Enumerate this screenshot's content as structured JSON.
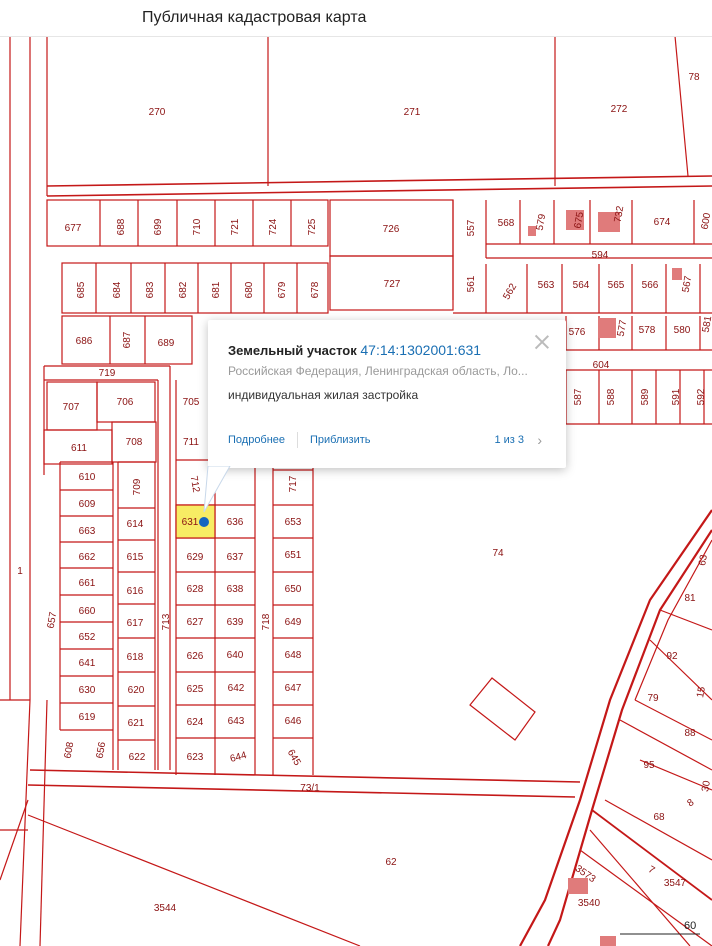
{
  "app": {
    "title": "Публичная кадастровая карта"
  },
  "popup": {
    "title": "Земельный участок",
    "cadastral_number": "47:14:1302001:631",
    "address": "Российская Федерация, Ленинградская область, Ло...",
    "usage": "индивидуальная жилая застройка",
    "details_label": "Подробнее",
    "zoom_label": "Приблизить",
    "page": "1 из 3"
  },
  "scale": {
    "label": "60"
  },
  "colors": {
    "boundary": "#c41818",
    "label": "#8a1111",
    "highlight": "#f7ec64",
    "building": "#e07b7b",
    "link": "#1a6fb3",
    "marker": "#1565c0"
  },
  "map_labels": [
    "270",
    "271",
    "272",
    "78",
    "677",
    "688",
    "699",
    "710",
    "721",
    "724",
    "725",
    "726",
    "557",
    "568",
    "579",
    "675",
    "732",
    "674",
    "600",
    "594",
    "685",
    "684",
    "683",
    "682",
    "681",
    "680",
    "679",
    "678",
    "727",
    "561",
    "562",
    "563",
    "564",
    "565",
    "566",
    "567",
    "686",
    "687",
    "689",
    "576",
    "577",
    "578",
    "580",
    "581",
    "719",
    "604",
    "707",
    "706",
    "705",
    "587",
    "588",
    "589",
    "591",
    "592",
    "611",
    "708",
    "711",
    "610",
    "709",
    "712",
    "717",
    "609",
    "663",
    "614",
    "631",
    "636",
    "653",
    "662",
    "615",
    "629",
    "637",
    "651",
    "661",
    "616",
    "628",
    "638",
    "650",
    "660",
    "617",
    "627",
    "639",
    "649",
    "652",
    "713",
    "718",
    "618",
    "626",
    "640",
    "648",
    "641",
    "630",
    "620",
    "625",
    "642",
    "647",
    "619",
    "621",
    "624",
    "643",
    "646",
    "608",
    "656",
    "622",
    "623",
    "644",
    "645",
    "73/1",
    "1",
    "657",
    "74",
    "63",
    "81",
    "92",
    "79",
    "15",
    "88",
    "95",
    "30",
    "8",
    "68",
    "62",
    "3544",
    "3573",
    "7",
    "3547",
    "3540"
  ]
}
